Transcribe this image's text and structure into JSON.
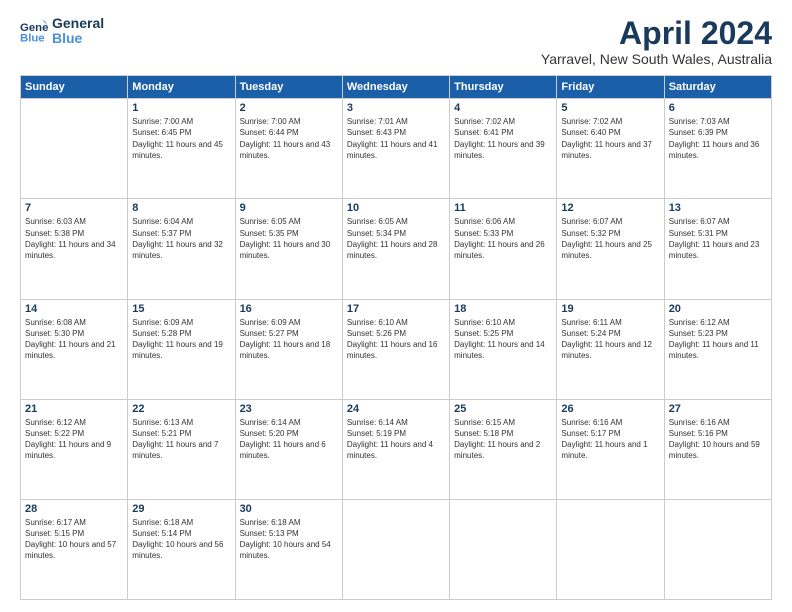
{
  "logo": {
    "line1": "General",
    "line2": "Blue"
  },
  "title": "April 2024",
  "location": "Yarravel, New South Wales, Australia",
  "weekdays": [
    "Sunday",
    "Monday",
    "Tuesday",
    "Wednesday",
    "Thursday",
    "Friday",
    "Saturday"
  ],
  "weeks": [
    [
      {
        "day": "",
        "sunrise": "",
        "sunset": "",
        "daylight": ""
      },
      {
        "day": "1",
        "sunrise": "Sunrise: 7:00 AM",
        "sunset": "Sunset: 6:45 PM",
        "daylight": "Daylight: 11 hours and 45 minutes."
      },
      {
        "day": "2",
        "sunrise": "Sunrise: 7:00 AM",
        "sunset": "Sunset: 6:44 PM",
        "daylight": "Daylight: 11 hours and 43 minutes."
      },
      {
        "day": "3",
        "sunrise": "Sunrise: 7:01 AM",
        "sunset": "Sunset: 6:43 PM",
        "daylight": "Daylight: 11 hours and 41 minutes."
      },
      {
        "day": "4",
        "sunrise": "Sunrise: 7:02 AM",
        "sunset": "Sunset: 6:41 PM",
        "daylight": "Daylight: 11 hours and 39 minutes."
      },
      {
        "day": "5",
        "sunrise": "Sunrise: 7:02 AM",
        "sunset": "Sunset: 6:40 PM",
        "daylight": "Daylight: 11 hours and 37 minutes."
      },
      {
        "day": "6",
        "sunrise": "Sunrise: 7:03 AM",
        "sunset": "Sunset: 6:39 PM",
        "daylight": "Daylight: 11 hours and 36 minutes."
      }
    ],
    [
      {
        "day": "7",
        "sunrise": "Sunrise: 6:03 AM",
        "sunset": "Sunset: 5:38 PM",
        "daylight": "Daylight: 11 hours and 34 minutes."
      },
      {
        "day": "8",
        "sunrise": "Sunrise: 6:04 AM",
        "sunset": "Sunset: 5:37 PM",
        "daylight": "Daylight: 11 hours and 32 minutes."
      },
      {
        "day": "9",
        "sunrise": "Sunrise: 6:05 AM",
        "sunset": "Sunset: 5:35 PM",
        "daylight": "Daylight: 11 hours and 30 minutes."
      },
      {
        "day": "10",
        "sunrise": "Sunrise: 6:05 AM",
        "sunset": "Sunset: 5:34 PM",
        "daylight": "Daylight: 11 hours and 28 minutes."
      },
      {
        "day": "11",
        "sunrise": "Sunrise: 6:06 AM",
        "sunset": "Sunset: 5:33 PM",
        "daylight": "Daylight: 11 hours and 26 minutes."
      },
      {
        "day": "12",
        "sunrise": "Sunrise: 6:07 AM",
        "sunset": "Sunset: 5:32 PM",
        "daylight": "Daylight: 11 hours and 25 minutes."
      },
      {
        "day": "13",
        "sunrise": "Sunrise: 6:07 AM",
        "sunset": "Sunset: 5:31 PM",
        "daylight": "Daylight: 11 hours and 23 minutes."
      }
    ],
    [
      {
        "day": "14",
        "sunrise": "Sunrise: 6:08 AM",
        "sunset": "Sunset: 5:30 PM",
        "daylight": "Daylight: 11 hours and 21 minutes."
      },
      {
        "day": "15",
        "sunrise": "Sunrise: 6:09 AM",
        "sunset": "Sunset: 5:28 PM",
        "daylight": "Daylight: 11 hours and 19 minutes."
      },
      {
        "day": "16",
        "sunrise": "Sunrise: 6:09 AM",
        "sunset": "Sunset: 5:27 PM",
        "daylight": "Daylight: 11 hours and 18 minutes."
      },
      {
        "day": "17",
        "sunrise": "Sunrise: 6:10 AM",
        "sunset": "Sunset: 5:26 PM",
        "daylight": "Daylight: 11 hours and 16 minutes."
      },
      {
        "day": "18",
        "sunrise": "Sunrise: 6:10 AM",
        "sunset": "Sunset: 5:25 PM",
        "daylight": "Daylight: 11 hours and 14 minutes."
      },
      {
        "day": "19",
        "sunrise": "Sunrise: 6:11 AM",
        "sunset": "Sunset: 5:24 PM",
        "daylight": "Daylight: 11 hours and 12 minutes."
      },
      {
        "day": "20",
        "sunrise": "Sunrise: 6:12 AM",
        "sunset": "Sunset: 5:23 PM",
        "daylight": "Daylight: 11 hours and 11 minutes."
      }
    ],
    [
      {
        "day": "21",
        "sunrise": "Sunrise: 6:12 AM",
        "sunset": "Sunset: 5:22 PM",
        "daylight": "Daylight: 11 hours and 9 minutes."
      },
      {
        "day": "22",
        "sunrise": "Sunrise: 6:13 AM",
        "sunset": "Sunset: 5:21 PM",
        "daylight": "Daylight: 11 hours and 7 minutes."
      },
      {
        "day": "23",
        "sunrise": "Sunrise: 6:14 AM",
        "sunset": "Sunset: 5:20 PM",
        "daylight": "Daylight: 11 hours and 6 minutes."
      },
      {
        "day": "24",
        "sunrise": "Sunrise: 6:14 AM",
        "sunset": "Sunset: 5:19 PM",
        "daylight": "Daylight: 11 hours and 4 minutes."
      },
      {
        "day": "25",
        "sunrise": "Sunrise: 6:15 AM",
        "sunset": "Sunset: 5:18 PM",
        "daylight": "Daylight: 11 hours and 2 minutes."
      },
      {
        "day": "26",
        "sunrise": "Sunrise: 6:16 AM",
        "sunset": "Sunset: 5:17 PM",
        "daylight": "Daylight: 11 hours and 1 minute."
      },
      {
        "day": "27",
        "sunrise": "Sunrise: 6:16 AM",
        "sunset": "Sunset: 5:16 PM",
        "daylight": "Daylight: 10 hours and 59 minutes."
      }
    ],
    [
      {
        "day": "28",
        "sunrise": "Sunrise: 6:17 AM",
        "sunset": "Sunset: 5:15 PM",
        "daylight": "Daylight: 10 hours and 57 minutes."
      },
      {
        "day": "29",
        "sunrise": "Sunrise: 6:18 AM",
        "sunset": "Sunset: 5:14 PM",
        "daylight": "Daylight: 10 hours and 56 minutes."
      },
      {
        "day": "30",
        "sunrise": "Sunrise: 6:18 AM",
        "sunset": "Sunset: 5:13 PM",
        "daylight": "Daylight: 10 hours and 54 minutes."
      },
      {
        "day": "",
        "sunrise": "",
        "sunset": "",
        "daylight": ""
      },
      {
        "day": "",
        "sunrise": "",
        "sunset": "",
        "daylight": ""
      },
      {
        "day": "",
        "sunrise": "",
        "sunset": "",
        "daylight": ""
      },
      {
        "day": "",
        "sunrise": "",
        "sunset": "",
        "daylight": ""
      }
    ]
  ]
}
